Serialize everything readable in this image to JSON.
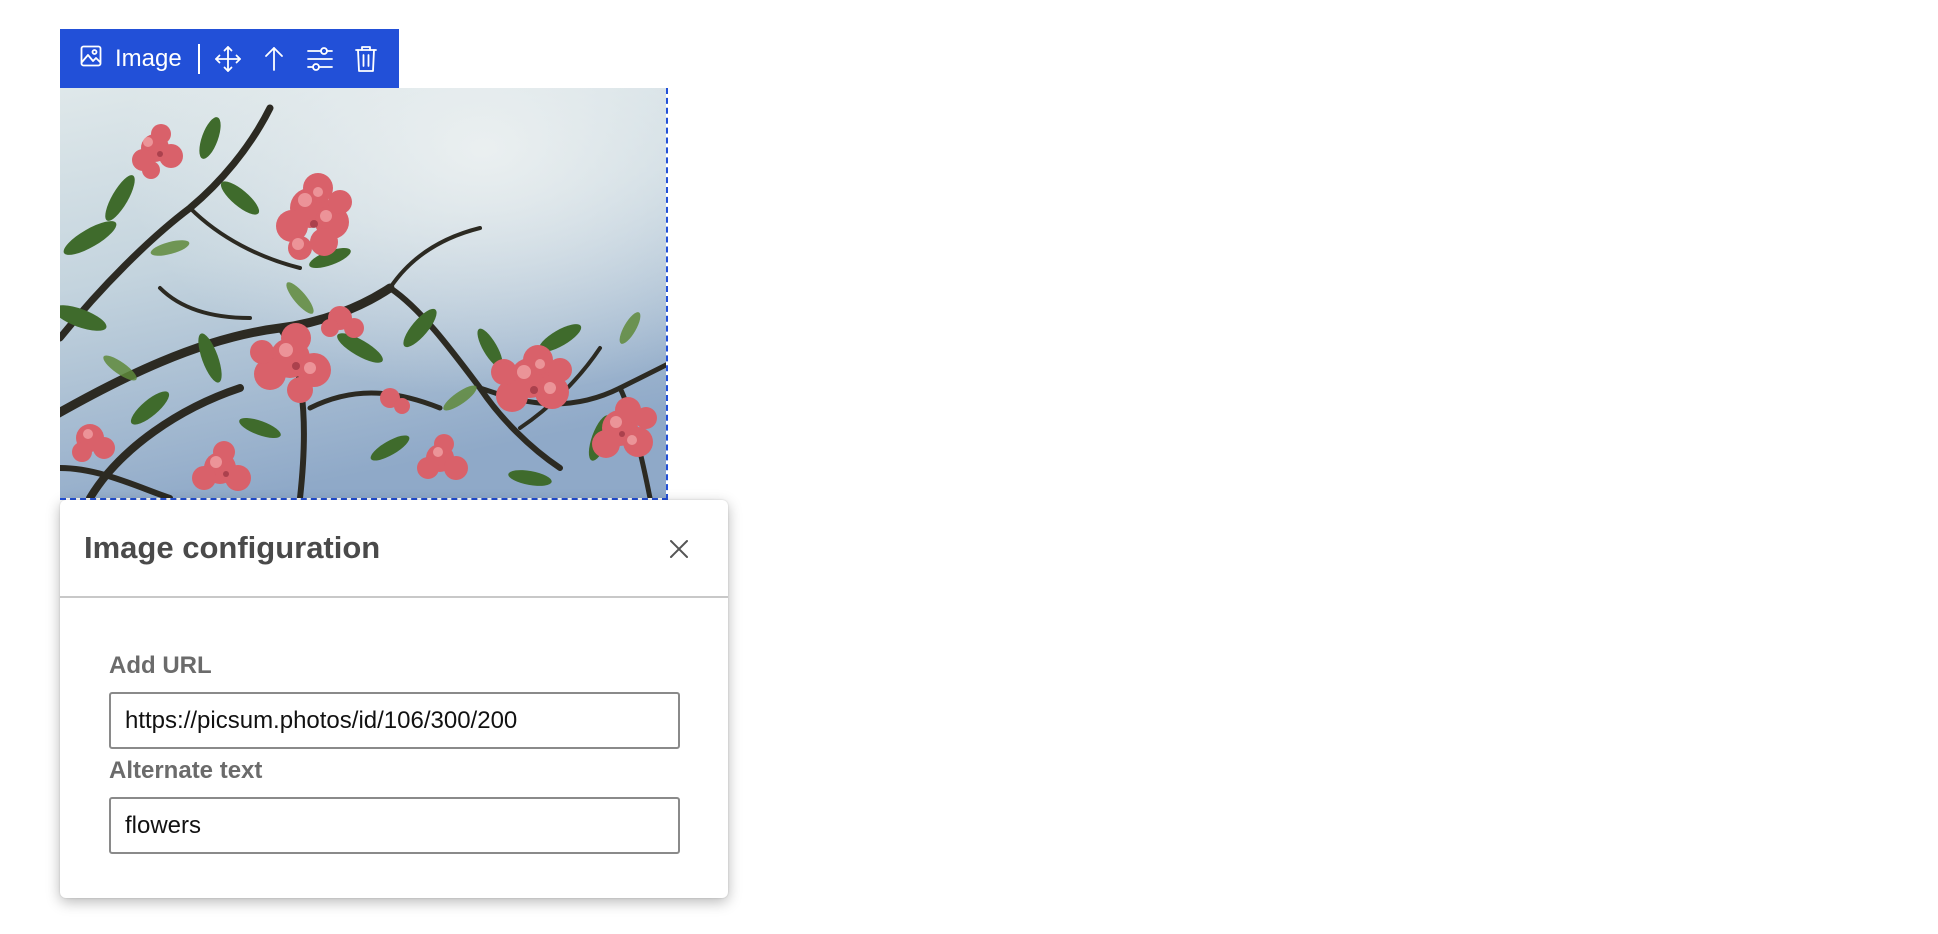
{
  "toolbar": {
    "block_label": "Image",
    "icons": [
      "image-icon",
      "move-icon",
      "arrow-up-icon",
      "settings-sliders-icon",
      "trash-icon"
    ],
    "accent_color": "#2250d8"
  },
  "image_block": {
    "alt": "flowers"
  },
  "config_popover": {
    "title": "Image configuration",
    "close_icon": "close-icon",
    "url_label": "Add URL",
    "url_value": "https://picsum.photos/id/106/300/200",
    "alt_label": "Alternate text",
    "alt_value": "flowers"
  }
}
